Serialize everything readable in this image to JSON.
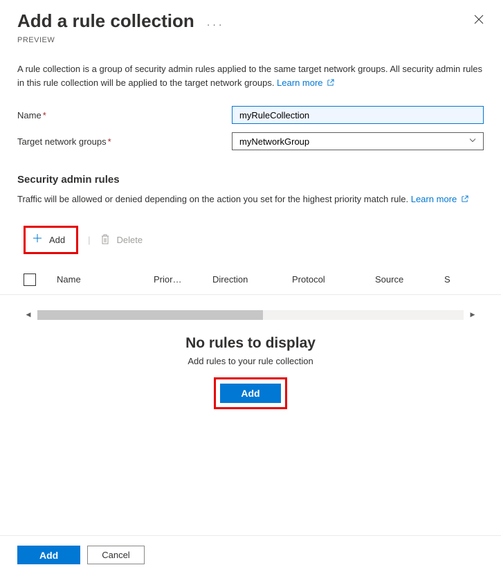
{
  "header": {
    "title": "Add a rule collection",
    "preview_label": "PREVIEW"
  },
  "description": {
    "text": "A rule collection is a group of security admin rules applied to the same target network groups. All security admin rules in this rule collection will be applied to the target network groups. ",
    "learn_more": "Learn more"
  },
  "form": {
    "name_label": "Name",
    "name_value": "myRuleCollection",
    "target_label": "Target network groups",
    "target_value": "myNetworkGroup"
  },
  "rules_section": {
    "header": "Security admin rules",
    "description": "Traffic will be allowed or denied depending on the action you set for the highest priority match rule. ",
    "learn_more": "Learn more"
  },
  "toolbar": {
    "add_label": "Add",
    "delete_label": "Delete"
  },
  "table": {
    "columns": {
      "name": "Name",
      "priority": "Prior…",
      "direction": "Direction",
      "protocol": "Protocol",
      "source": "Source",
      "extra": "S"
    }
  },
  "empty_state": {
    "title": "No rules to display",
    "subtitle": "Add rules to your rule collection",
    "add_label": "Add"
  },
  "footer": {
    "add_label": "Add",
    "cancel_label": "Cancel"
  }
}
